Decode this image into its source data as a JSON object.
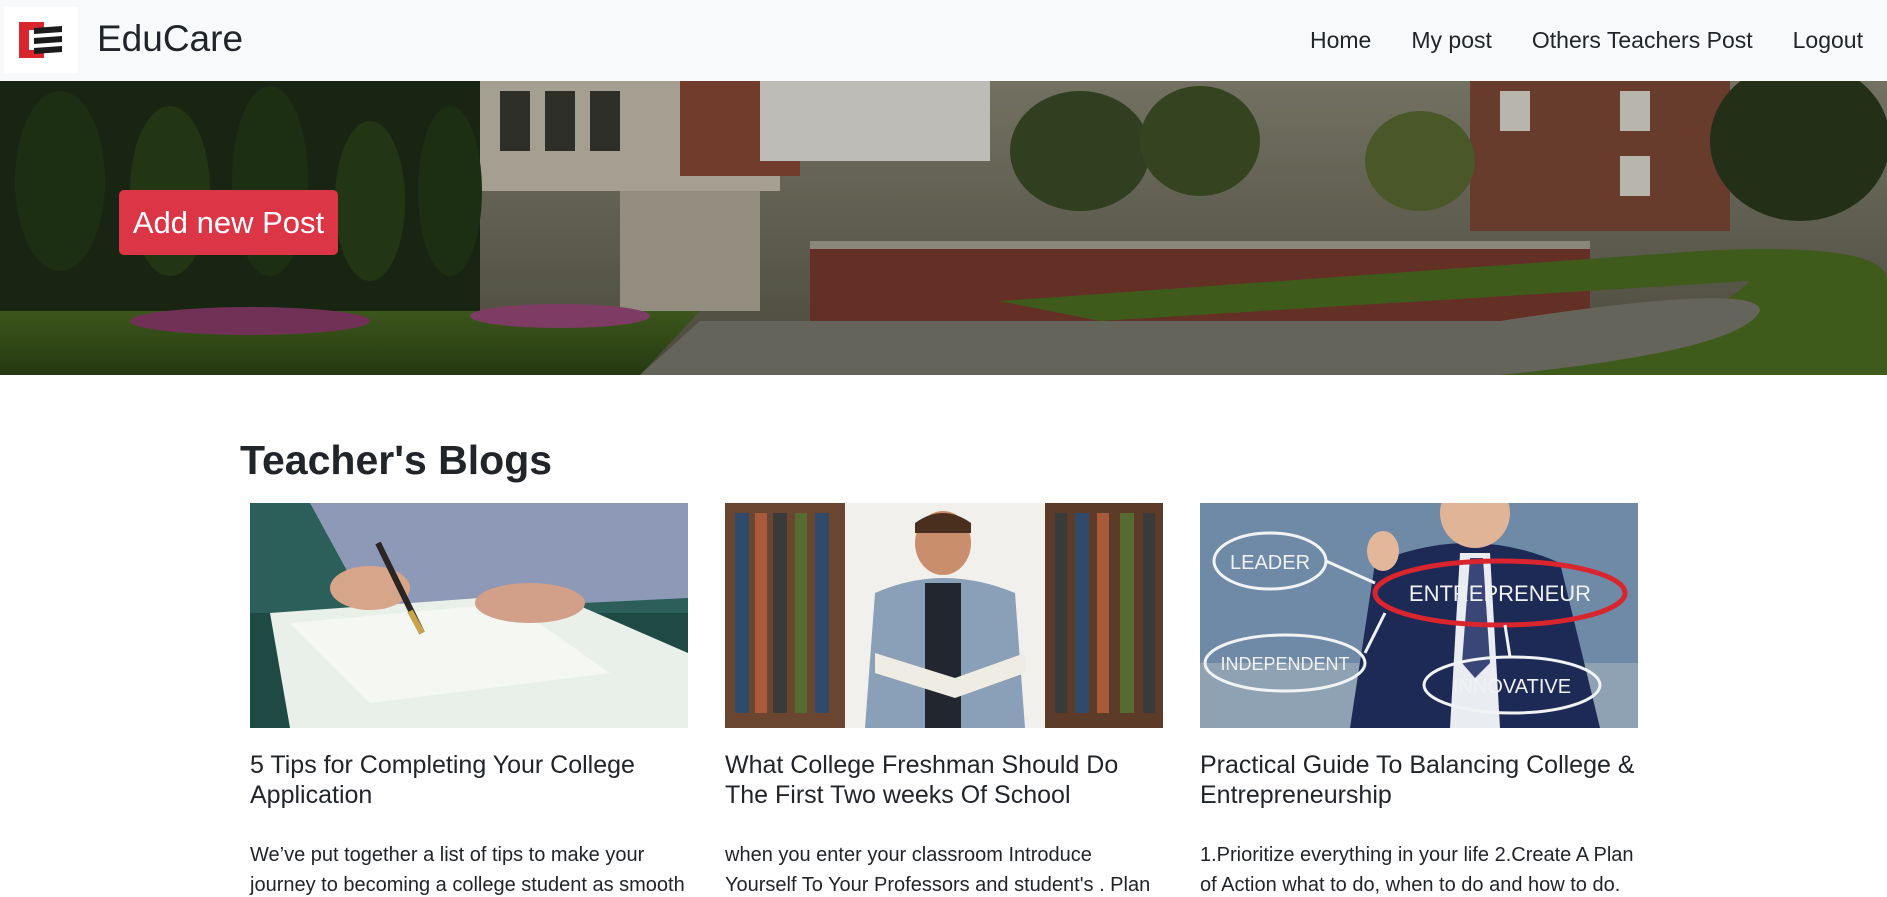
{
  "brand": {
    "name": "EduCare"
  },
  "nav": {
    "home": "Home",
    "my_post": "My post",
    "others": "Others Teachers Post",
    "logout": "Logout"
  },
  "hero": {
    "add_post_label": "Add new Post"
  },
  "blogs": {
    "title": "Teacher's Blogs",
    "cards": [
      {
        "title": "5 Tips for Completing Your College Application",
        "text": "We’ve put together a list of tips to make your journey to becoming a college student as smooth"
      },
      {
        "title": "What College Freshman Should Do The First Two weeks Of School",
        "text": "when you enter your classroom Introduce Yourself To Your Professors and student's . Plan Out Your"
      },
      {
        "title": "Practical Guide To Balancing College & Entrepreneurship",
        "text": "1.Prioritize everything in your life 2.Create A Plan of Action what to do, when to do and how to do."
      }
    ],
    "image3_labels": {
      "leader": "LEADER",
      "entrepreneur": "ENTREPRENEUR",
      "independent": "INDEPENDENT",
      "innovative": "INNOVATIVE"
    }
  },
  "colors": {
    "accent_button": "#dc3545",
    "navbar_bg": "#f8f9fa",
    "text": "#212529"
  }
}
